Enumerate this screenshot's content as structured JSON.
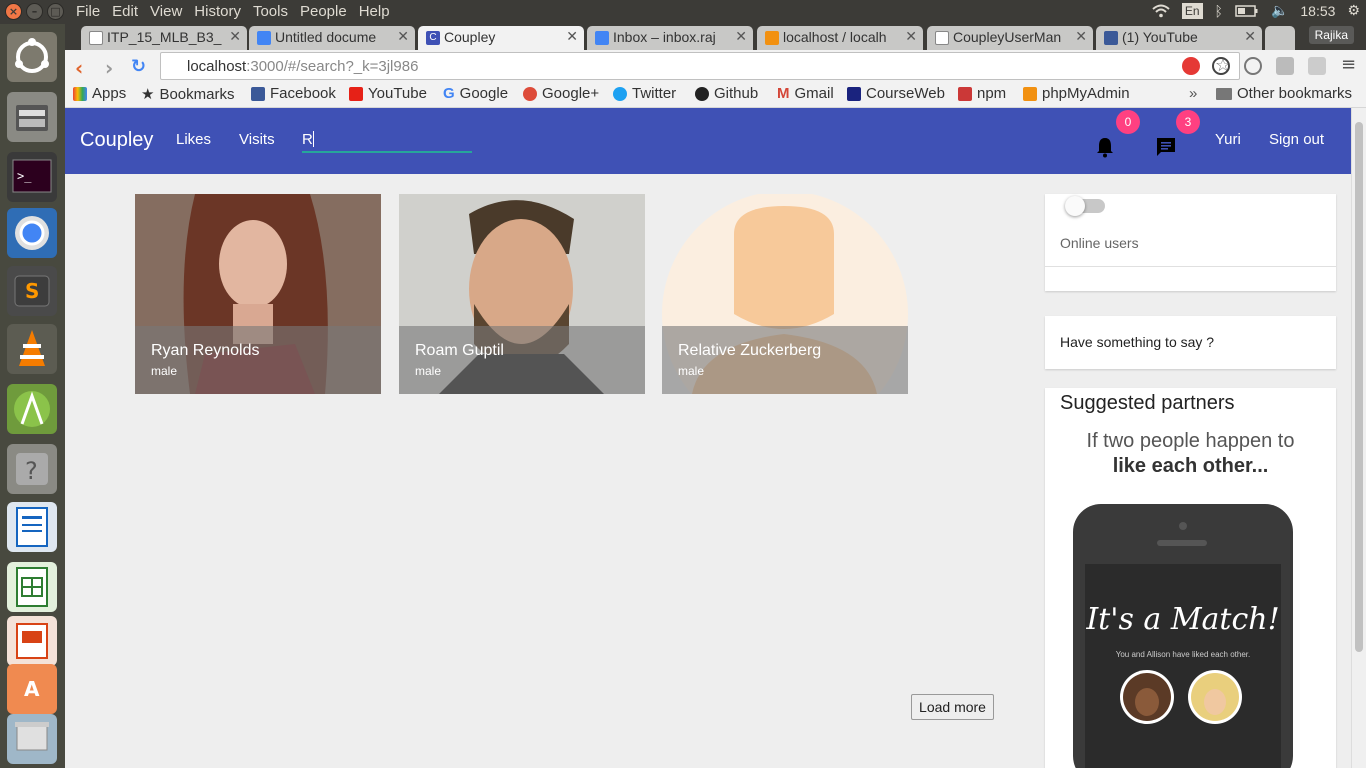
{
  "os": {
    "menu": [
      "File",
      "Edit",
      "View",
      "History",
      "Tools",
      "People",
      "Help"
    ],
    "lang": "En",
    "clock": "18:53",
    "launcher_icons": [
      "ubuntu-dash-icon",
      "files-icon",
      "terminal-icon",
      "chrome-icon",
      "sublime-icon",
      "vlc-icon",
      "android-studio-icon",
      "help-icon",
      "writer-icon",
      "calc-icon",
      "impress-icon",
      "software-center-icon",
      "trash-icon"
    ]
  },
  "browser": {
    "tabs": [
      {
        "title": "ITP_15_MLB_B3_",
        "color": "#888888"
      },
      {
        "title": "Untitled docume",
        "color": "#4285f4"
      },
      {
        "title": "Coupley",
        "color": "#3f51b5"
      },
      {
        "title": "Inbox – inbox.raj",
        "color": "#4285f4"
      },
      {
        "title": "localhost / localh",
        "color": "#f29111"
      },
      {
        "title": "CoupleyUserMan",
        "color": "#888888"
      },
      {
        "title": "(1) YouTube",
        "color": "#3b5998"
      }
    ],
    "profile": "Rajika",
    "url_host": "localhost",
    "url_rest": ":3000/#/search?_k=3jl986",
    "bookmarks": [
      "Apps",
      "Bookmarks",
      "Facebook",
      "YouTube",
      "Google",
      "Google+",
      "Twitter",
      "Github",
      "Gmail",
      "CourseWeb",
      "npm",
      "phpMyAdmin"
    ],
    "bookmark_overflow": "»",
    "other_bookmarks": "Other bookmarks"
  },
  "app": {
    "brand": "Coupley",
    "nav": {
      "likes": "Likes",
      "visits": "Visits"
    },
    "search_value": "R",
    "notifications_count": "0",
    "messages_count": "3",
    "user": "Yuri",
    "signout": "Sign out",
    "results": [
      {
        "name": "Ryan Reynolds",
        "gender": "male"
      },
      {
        "name": "Roam Guptil",
        "gender": "male"
      },
      {
        "name": "Relative Zuckerberg",
        "gender": "male"
      }
    ],
    "load_more": "Load more",
    "sidebar": {
      "online_users": "Online users",
      "say_something": "Have something to say ?",
      "suggested_title": "Suggested partners",
      "promo_line1": "If two people happen to",
      "promo_line2": "like each other...",
      "match_title": "It's a Match!",
      "match_sub": "You and Allison have liked each other."
    }
  }
}
